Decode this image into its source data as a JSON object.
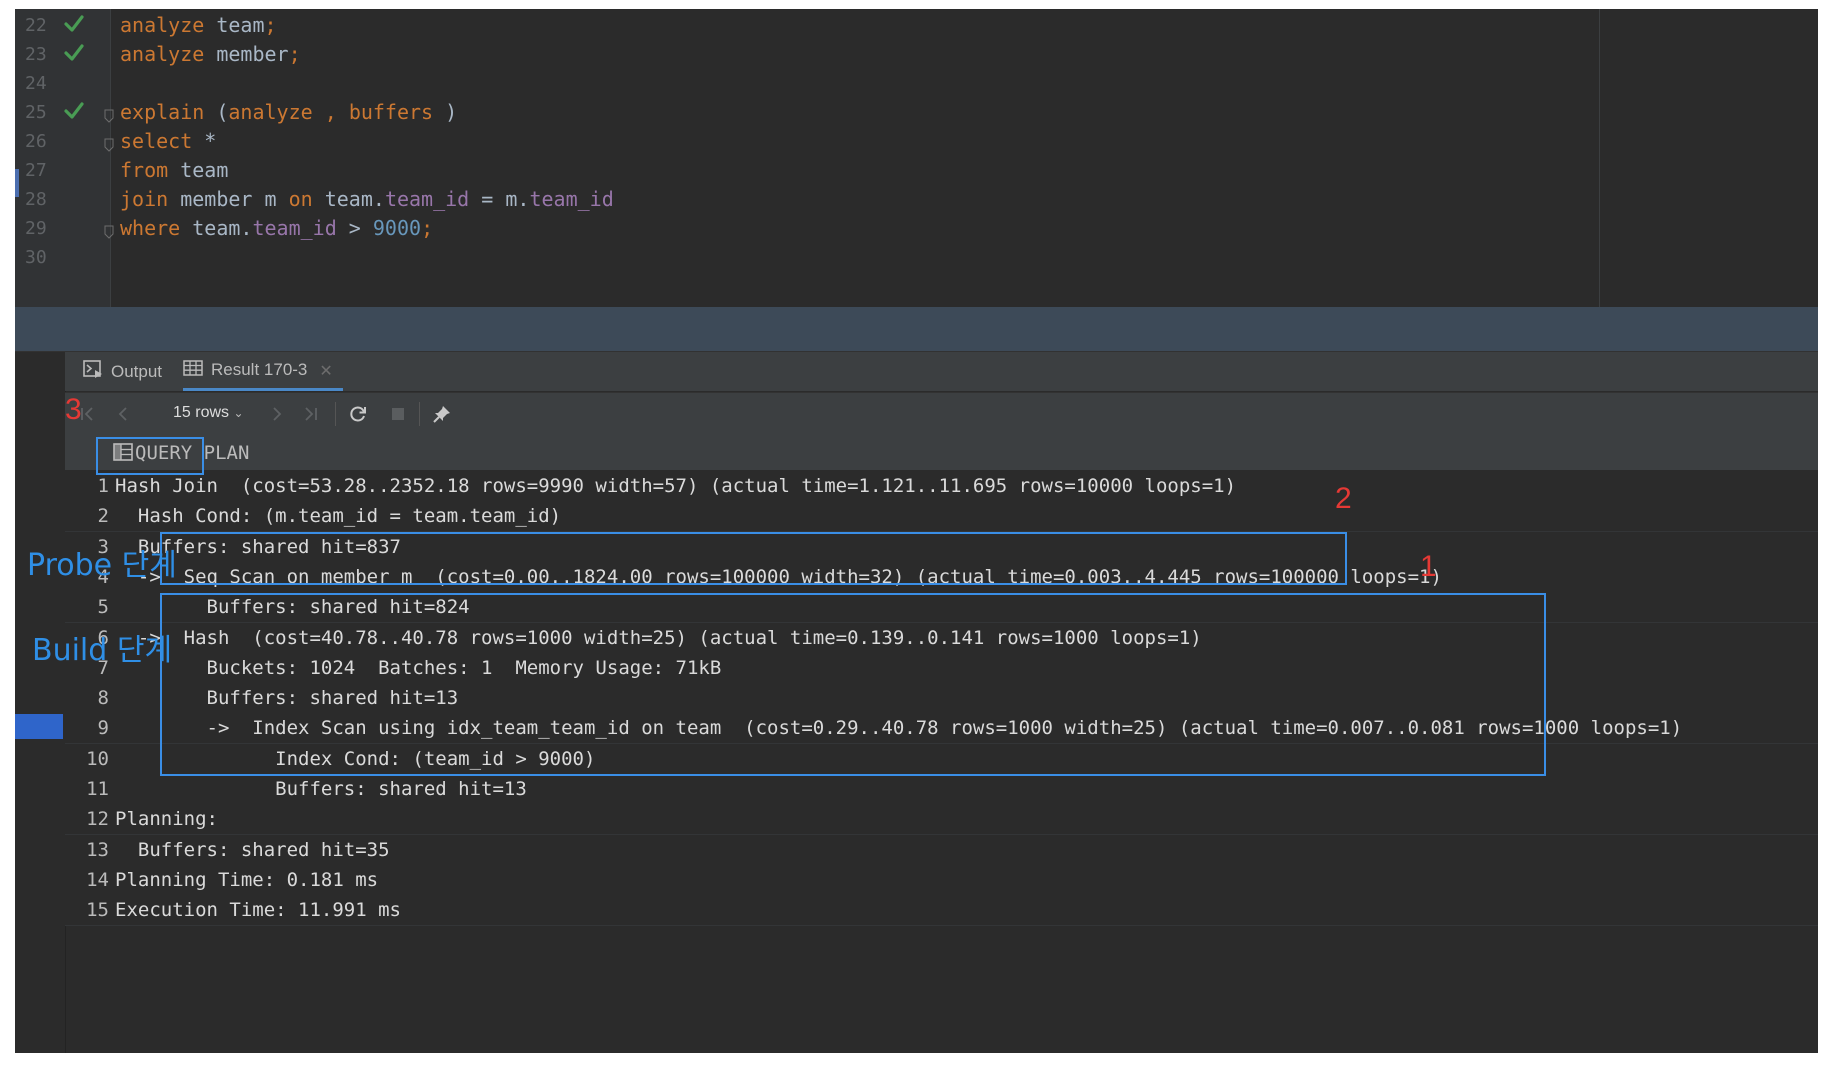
{
  "editor": {
    "lines": [
      {
        "num": "22",
        "check": true,
        "fold": false,
        "tokens": [
          {
            "t": "analyze",
            "c": "kw"
          },
          {
            "t": " team",
            "c": ""
          },
          {
            "t": ";",
            "c": "kw"
          }
        ]
      },
      {
        "num": "23",
        "check": true,
        "fold": false,
        "tokens": [
          {
            "t": "analyze",
            "c": "kw"
          },
          {
            "t": " member",
            "c": ""
          },
          {
            "t": ";",
            "c": "kw"
          }
        ]
      },
      {
        "num": "24",
        "check": false,
        "fold": false,
        "tokens": []
      },
      {
        "num": "25",
        "check": true,
        "fold": true,
        "tokens": [
          {
            "t": "explain",
            "c": "kw"
          },
          {
            "t": " (",
            "c": ""
          },
          {
            "t": "analyze ",
            "c": "kw"
          },
          {
            "t": ", ",
            "c": "kw"
          },
          {
            "t": "buffers ",
            "c": "kw"
          },
          {
            "t": ")",
            "c": ""
          }
        ]
      },
      {
        "num": "26",
        "check": false,
        "fold": true,
        "tokens": [
          {
            "t": "select",
            "c": "kw"
          },
          {
            "t": " *",
            "c": ""
          }
        ]
      },
      {
        "num": "27",
        "check": false,
        "fold": false,
        "tokens": [
          {
            "t": "from",
            "c": "kw"
          },
          {
            "t": " team",
            "c": ""
          }
        ]
      },
      {
        "num": "28",
        "check": false,
        "fold": false,
        "tokens": [
          {
            "t": "join",
            "c": "kw"
          },
          {
            "t": " member m ",
            "c": ""
          },
          {
            "t": "on",
            "c": "kw"
          },
          {
            "t": " team.",
            "c": ""
          },
          {
            "t": "team_id",
            "c": "fld"
          },
          {
            "t": " = m.",
            "c": ""
          },
          {
            "t": "team_id",
            "c": "fld"
          }
        ]
      },
      {
        "num": "29",
        "check": false,
        "fold": true,
        "tokens": [
          {
            "t": "where",
            "c": "kw"
          },
          {
            "t": " team.",
            "c": ""
          },
          {
            "t": "team_id",
            "c": "fld"
          },
          {
            "t": " > ",
            "c": ""
          },
          {
            "t": "9000",
            "c": "num"
          },
          {
            "t": ";",
            "c": "kw"
          }
        ]
      },
      {
        "num": "30",
        "check": false,
        "fold": false,
        "tokens": []
      }
    ]
  },
  "tabs": [
    {
      "label": "Output",
      "icon": "output-console-icon"
    },
    {
      "label": "Result 170-3",
      "icon": "table-grid-icon",
      "closable": true
    }
  ],
  "toolbar": {
    "rows_label": "15 rows"
  },
  "grid": {
    "column": "QUERY PLAN",
    "rows": [
      {
        "n": "1",
        "v": "Hash Join  (cost=53.28..2352.18 rows=9990 width=57) (actual time=1.121..11.695 rows=10000 loops=1)"
      },
      {
        "n": "2",
        "v": "  Hash Cond: (m.team_id = team.team_id)"
      },
      {
        "n": "3",
        "v": "  Buffers: shared hit=837"
      },
      {
        "n": "4",
        "v": "  ->  Seq Scan on member m  (cost=0.00..1824.00 rows=100000 width=32) (actual time=0.003..4.445 rows=100000 loops=1)"
      },
      {
        "n": "5",
        "v": "        Buffers: shared hit=824"
      },
      {
        "n": "6",
        "v": "  ->  Hash  (cost=40.78..40.78 rows=1000 width=25) (actual time=0.139..0.141 rows=1000 loops=1)"
      },
      {
        "n": "7",
        "v": "        Buckets: 1024  Batches: 1  Memory Usage: 71kB"
      },
      {
        "n": "8",
        "v": "        Buffers: shared hit=13"
      },
      {
        "n": "9",
        "v": "        ->  Index Scan using idx_team_team_id on team  (cost=0.29..40.78 rows=1000 width=25) (actual time=0.007..0.081 rows=1000 loops=1)"
      },
      {
        "n": "10",
        "v": "              Index Cond: (team_id > 9000)"
      },
      {
        "n": "11",
        "v": "              Buffers: shared hit=13"
      },
      {
        "n": "12",
        "v": "Planning:"
      },
      {
        "n": "13",
        "v": "  Buffers: shared hit=35"
      },
      {
        "n": "14",
        "v": "Planning Time: 0.181 ms"
      },
      {
        "n": "15",
        "v": "Execution Time: 11.991 ms"
      }
    ]
  },
  "annotations": {
    "step1": "1",
    "step2": "2",
    "step3": "3",
    "probe": "Probe 단계",
    "build": "Build 단계"
  },
  "colors": {
    "keyword": "#cc7832",
    "field": "#9876aa",
    "number": "#6897bb",
    "annotation_box": "#3a8ee6",
    "annotation_red": "#e53935",
    "selection": "#2f65ca"
  }
}
